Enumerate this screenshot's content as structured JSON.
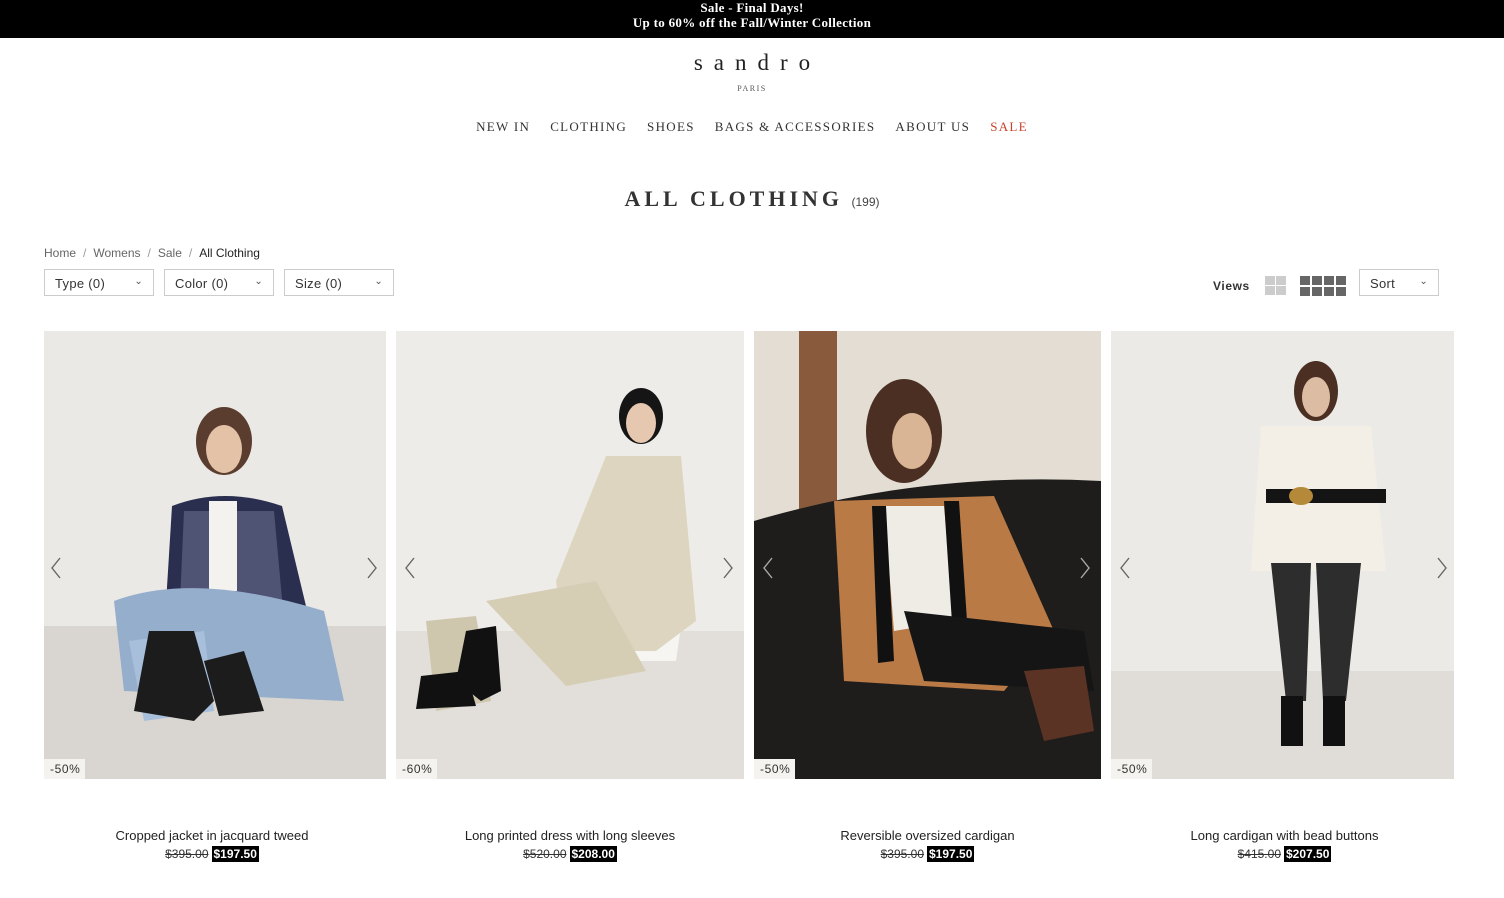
{
  "promo": {
    "line1": "Sale - Final Days!",
    "line2": "Up to 60% off the Fall/Winter Collection"
  },
  "brand": {
    "name": "sandro",
    "sub": "PARIS"
  },
  "nav": {
    "items": [
      "NEW IN",
      "CLOTHING",
      "SHOES",
      "BAGS & ACCESSORIES",
      "ABOUT US",
      "SALE"
    ],
    "sale_color": "#c9412d"
  },
  "page": {
    "title": "ALL CLOTHING",
    "count": "(199)"
  },
  "breadcrumb": [
    "Home",
    "Womens",
    "Sale",
    "All Clothing"
  ],
  "filters": [
    "Type (0)",
    "Color (0)",
    "Size (0)"
  ],
  "views_label": "Views",
  "sort_label": "Sort",
  "products": [
    {
      "name": "Cropped jacket in jacquard tweed",
      "old_price": "$395.00",
      "new_price": "$197.50",
      "discount": "-50%",
      "image": "woman seated on floor in navy check tweed jacket and wide jeans"
    },
    {
      "name": "Long printed dress with long sleeves",
      "old_price": "$520.00",
      "new_price": "$208.00",
      "discount": "-60%",
      "image": "woman seated on white chair in printed cream dress"
    },
    {
      "name": "Reversible oversized cardigan",
      "old_price": "$395.00",
      "new_price": "$197.50",
      "discount": "-50%",
      "image": "woman on leather sofa in camel patterned cardigan"
    },
    {
      "name": "Long cardigan with bead buttons",
      "old_price": "$415.00",
      "new_price": "$207.50",
      "discount": "-50%",
      "image": "woman standing in ivory long belted cardigan and black jeans"
    }
  ],
  "icons": {
    "prev": "chevron-left-icon",
    "next": "chevron-right-icon",
    "dropdown": "chevron-down-icon"
  }
}
